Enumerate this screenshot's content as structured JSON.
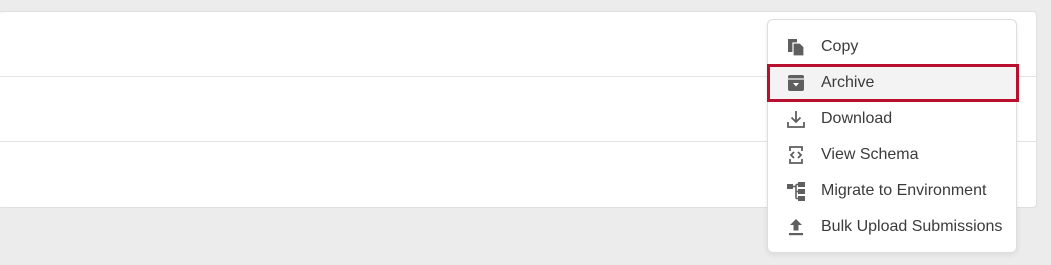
{
  "menu": {
    "items": [
      {
        "label": "Copy",
        "icon": "copy-icon"
      },
      {
        "label": "Archive",
        "icon": "archive-icon",
        "highlighted": true
      },
      {
        "label": "Download",
        "icon": "download-icon"
      },
      {
        "label": "View Schema",
        "icon": "code-icon"
      },
      {
        "label": "Migrate to Environment",
        "icon": "migrate-icon"
      },
      {
        "label": "Bulk Upload Submissions",
        "icon": "upload-icon"
      }
    ]
  },
  "colors": {
    "highlight_border": "#b8102e",
    "icon": "#5f5f5f",
    "text": "#3b3b3b"
  }
}
